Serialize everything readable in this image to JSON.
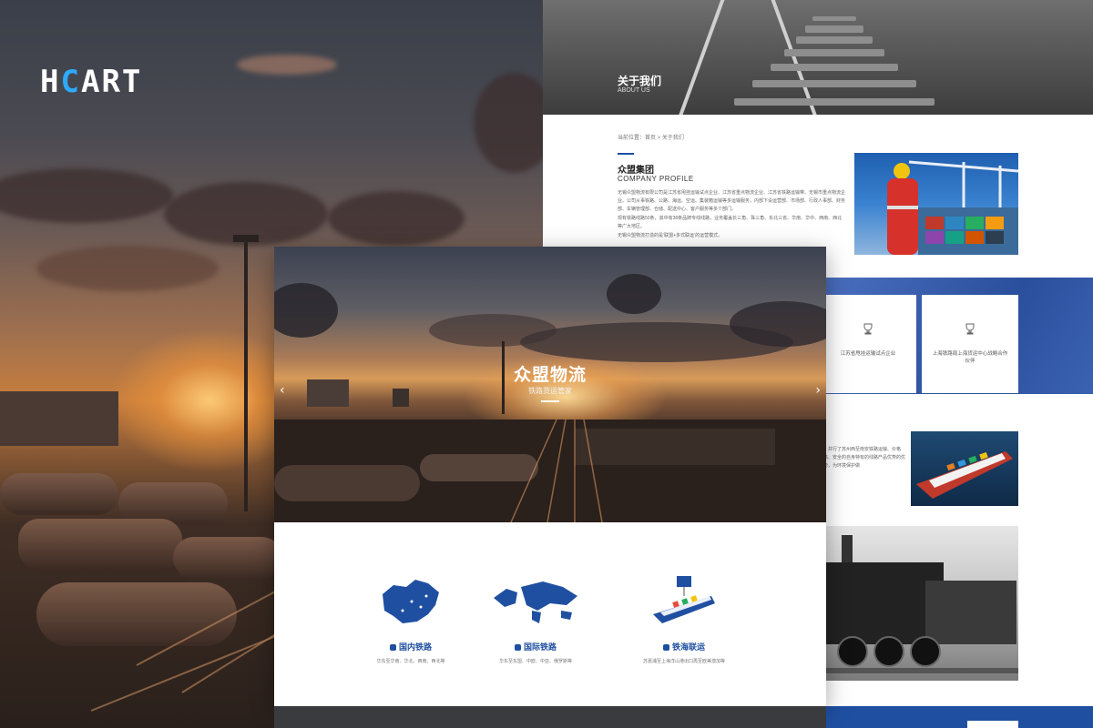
{
  "brand": {
    "logo_text_a": "H",
    "logo_text_b": "C",
    "logo_text_c": "ART"
  },
  "about_page": {
    "banner_title": "关于我们",
    "banner_subtitle": "ABOUT US",
    "breadcrumb": "当前位置：首页 > 关于我们",
    "section_title": "众盟集团",
    "section_subtitle": "COMPANY PROFILE",
    "paragraphs": [
      "无锡众盟物流有限公司是江苏省甩挂运输试点企业、江苏省重点物流企业、江苏省铁路运输带、无锡市重点物流企业。公司从事铁路、公路、海运、空运、集装箱运输等多运输服务，内部下设运营部、市场部、行政人事部、财务部、车辆管理部、仓储、配送中心、客户服务等多个部门。",
      "现有铁路线路50条，其中有38条品牌专线线路，业务覆盖长三角、珠三角、东北三省、华南、华中、西南、西北等广大地区。",
      "无锡众盟物流打造的是‘联盟+多式联运’的运营模式。"
    ]
  },
  "cards": [
    {
      "label": "江苏省甩挂运输试点企业"
    },
    {
      "label": "上海铁路局上海货运中心战略合作伙伴"
    }
  ],
  "ship_text": "，并行了苏州西至南安铁路运输、价格高、安全的自身特有的线路产品优势的优势，为环境保护做",
  "hero": {
    "title": "众盟物流",
    "subtitle": "铁路货运管家",
    "prev_arrow": "‹",
    "next_arrow": "›"
  },
  "services": [
    {
      "title": "国内铁路",
      "desc": "华东至华南、华北、西南、西北等"
    },
    {
      "title": "国际铁路",
      "desc": "华东至东盟、中欧、中亚、俄罗斯等"
    },
    {
      "title": "铁海联运",
      "desc": "苏嘉浦至上海洋山港出口再至欧美澳加等"
    }
  ],
  "colors": {
    "primary_blue": "#1f4fa1",
    "accent_cyan": "#2fa8ff"
  }
}
